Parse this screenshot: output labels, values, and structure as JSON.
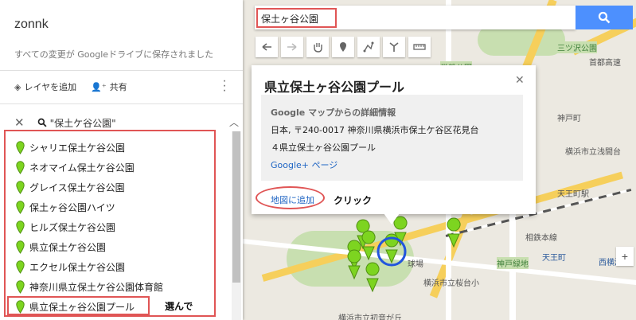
{
  "panel": {
    "map_title": "zonnk",
    "saved_status": "すべての変更が Googleドライブに保存されました",
    "add_layer_label": "レイヤを追加",
    "share_label": "共有",
    "search_query": "\"保土ケ谷公園\"",
    "results": [
      "シャリエ保土ケ谷公園",
      "ネオマイム保土ケ谷公園",
      "グレイス保土ケ谷公園",
      "保土ヶ谷公園ハイツ",
      "ヒルズ保土ケ谷公園",
      "県立保土ケ谷公園",
      "エクセル保土ケ谷公園",
      "神奈川県立保土ケ谷公園体育館",
      "県立保土ヶ谷公園プール"
    ],
    "annotation_choose": "選んで"
  },
  "search": {
    "value": "保土ヶ谷公園"
  },
  "popup": {
    "title": "県立保土ヶ谷公園プール",
    "details_header": "Google マップからの詳細情報",
    "address_line1": "日本, 〒240-0017 神奈川県横浜市保土ケ谷区花見台",
    "address_line2": "４県立保土ヶ谷公園プール",
    "gplus_link": "Google+ ページ",
    "add_to_map": "地図に追加",
    "annotation_click": "クリック"
  },
  "map_labels": {
    "label_1": "三ツ沢公園",
    "label_2": "首都高速",
    "label_3": "横浜市立浅間台",
    "label_4": "天王町駅",
    "label_5": "相鉄本線",
    "label_6": "天王町",
    "label_7": "西横浜",
    "label_8": "神戸緑地",
    "label_9": "球場",
    "label_10": "横浜市立桜台小",
    "label_11": "横浜市立初音が丘",
    "label_12": "常盤公園",
    "label_13": "神戸町"
  },
  "colors": {
    "accent_blue": "#4d90fe",
    "annotation_red": "#e05555",
    "pin_green": "#7dd420"
  },
  "icons": {
    "search": "search-icon",
    "undo": "undo-icon",
    "redo": "redo-icon",
    "pan": "hand-icon",
    "marker": "marker-icon",
    "line": "draw-line-icon",
    "directions": "directions-icon",
    "measure": "ruler-icon"
  }
}
